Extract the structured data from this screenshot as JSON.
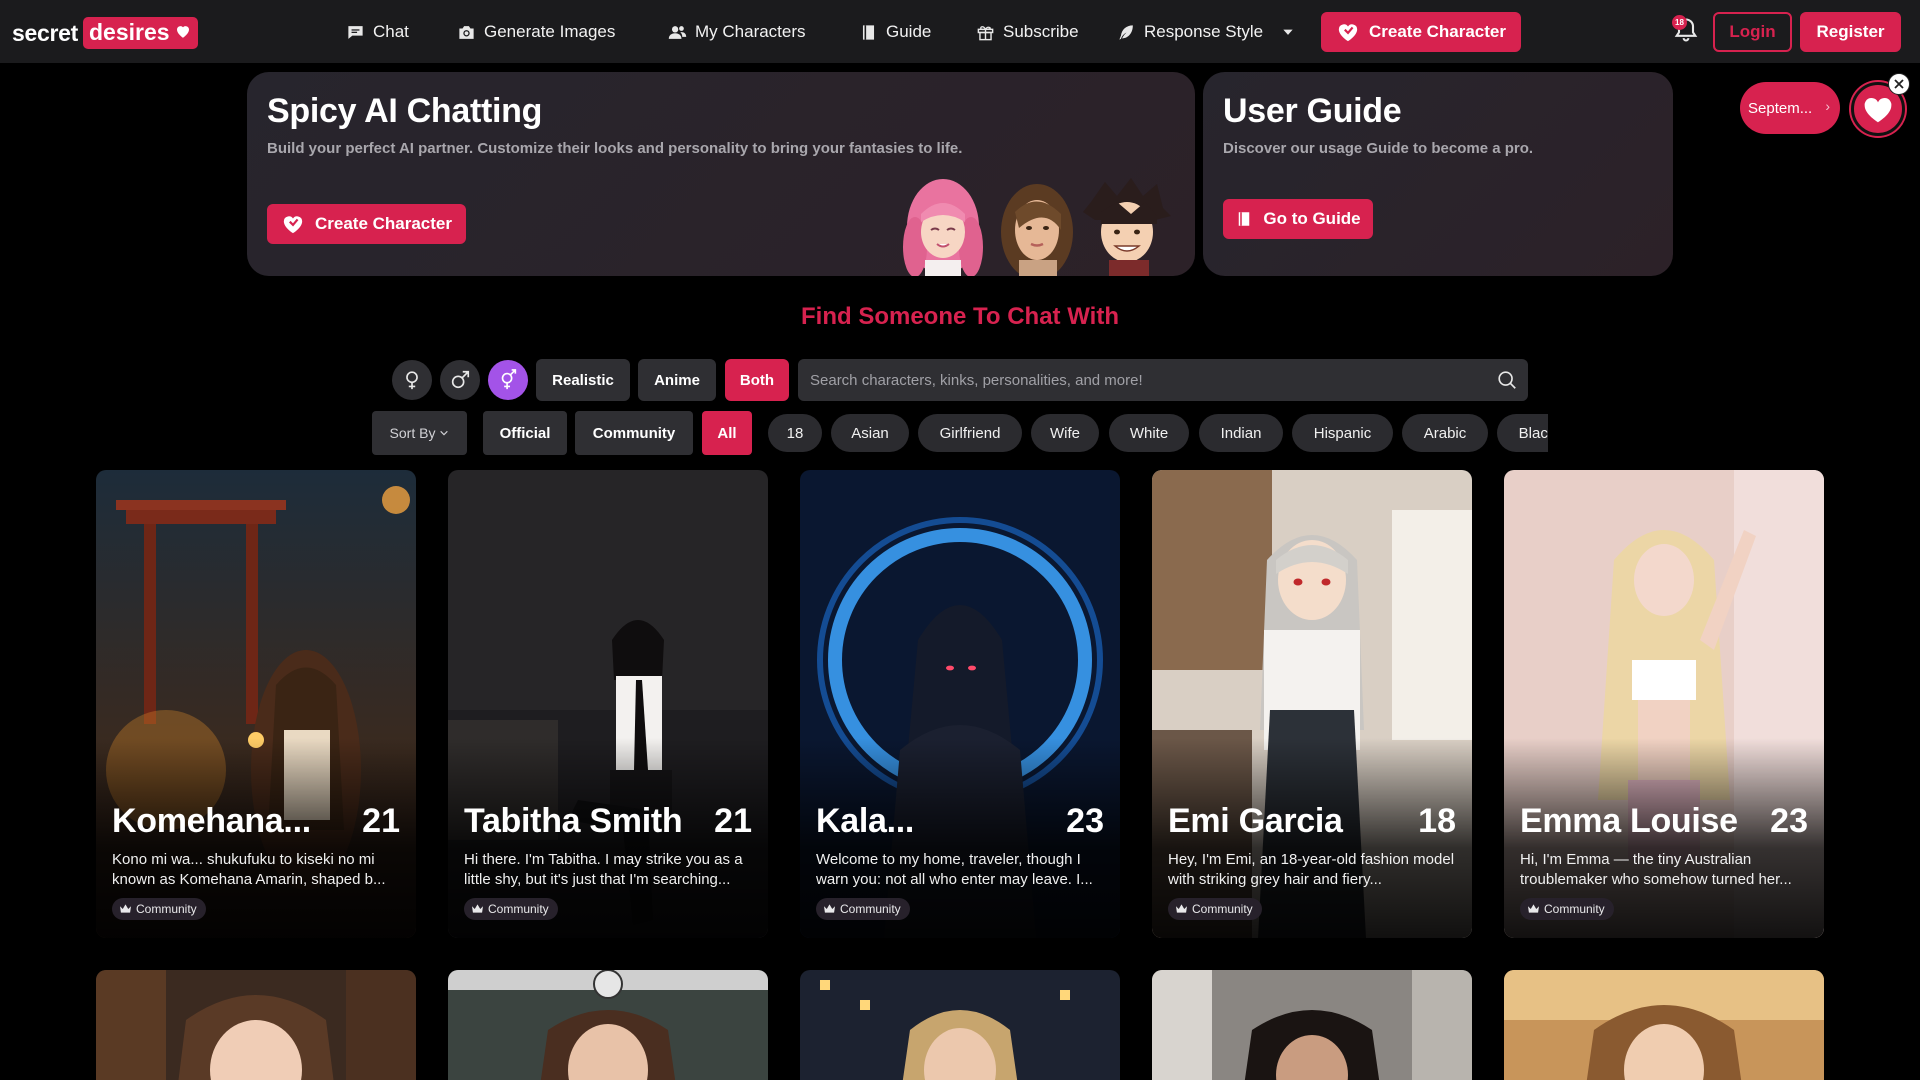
{
  "brand": {
    "name_a": "secret",
    "name_b": "desires"
  },
  "nav": {
    "links": [
      {
        "label": "Chat",
        "icon": "chat-icon"
      },
      {
        "label": "Generate Images",
        "icon": "camera-icon"
      },
      {
        "label": "My Characters",
        "icon": "users-icon"
      },
      {
        "label": "Guide",
        "icon": "book-icon"
      },
      {
        "label": "Subscribe",
        "icon": "gift-icon"
      },
      {
        "label": "Response Style",
        "icon": "feather-icon"
      }
    ],
    "create_label": "Create Character",
    "notification_count": "18",
    "login_label": "Login",
    "register_label": "Register"
  },
  "hero": {
    "title": "Spicy AI Chatting",
    "subtitle": "Build your perfect AI partner. Customize their looks and personality to bring your fantasies to life.",
    "button": "Create Character"
  },
  "guide": {
    "title": "User Guide",
    "subtitle": "Discover our usage Guide to become a pro.",
    "button": "Go to Guide"
  },
  "promo": {
    "label": "Septem...",
    "chevron": "›"
  },
  "find": {
    "title": "Find Someone To Chat With",
    "style_buttons": [
      "Realistic",
      "Anime",
      "Both"
    ],
    "active_style": "Both",
    "search_placeholder": "Search characters, kinks, personalities, and more!",
    "gender_options": [
      "female-symbol-icon",
      "male-symbol-icon",
      "both-genders-icon"
    ],
    "active_gender": "both-genders-icon"
  },
  "filters": {
    "sort_label": "Sort By",
    "tabs": [
      "Official",
      "Community",
      "All"
    ],
    "active_tab": "All",
    "tags": [
      "18",
      "Asian",
      "Girlfriend",
      "Wife",
      "White",
      "Indian",
      "Hispanic",
      "Arabic",
      "Black"
    ]
  },
  "cards": [
    {
      "name": "Komehana...",
      "age": "21",
      "desc": "Kono mi wa... shukufuku to kiseki no mi known as Komehana Amarin, shaped b...",
      "badge": "Community"
    },
    {
      "name": "Tabitha Smith",
      "age": "21",
      "desc": "Hi there. I'm Tabitha. I may strike you as a little shy, but it's just that I'm searching...",
      "badge": "Community"
    },
    {
      "name": "Kala...",
      "age": "23",
      "desc": "Welcome to my home, traveler, though I warn you: not all who enter may leave. I...",
      "badge": "Community"
    },
    {
      "name": "Emi Garcia",
      "age": "18",
      "desc": "Hey, I'm Emi, an 18-year-old fashion model with striking grey hair and fiery...",
      "badge": "Community"
    },
    {
      "name": "Emma Louise",
      "age": "23",
      "desc": "Hi, I'm Emma — the tiny Australian troublemaker who somehow turned her...",
      "badge": "Community"
    }
  ],
  "colors": {
    "accent": "#d7224f",
    "nav_bg": "#1b1b1d",
    "panel": "#2f2f33",
    "page_bg": "#000000"
  }
}
